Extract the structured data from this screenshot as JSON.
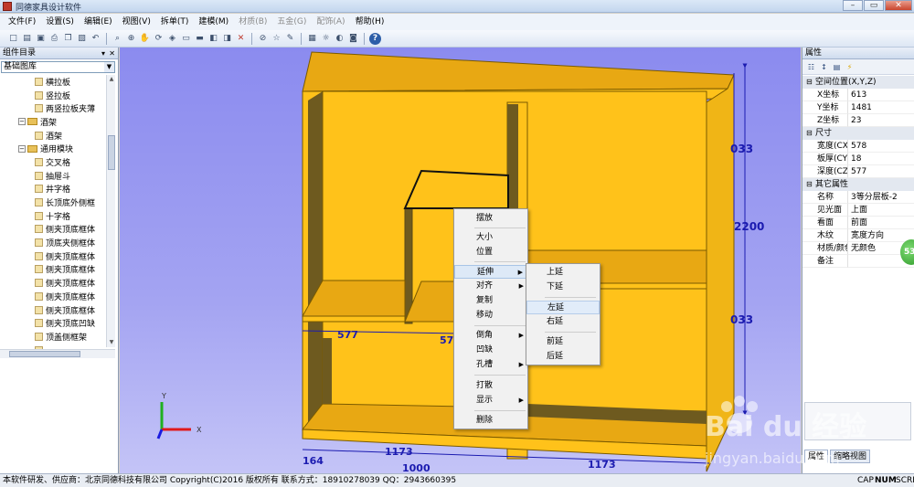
{
  "window": {
    "title": "同德家具设计软件",
    "controls": {
      "minimize": "–",
      "maximize": "▭",
      "close": "✕"
    }
  },
  "menubar": {
    "items": [
      {
        "label": "文件(F)",
        "enabled": true
      },
      {
        "label": "设置(S)",
        "enabled": true
      },
      {
        "label": "编辑(E)",
        "enabled": true
      },
      {
        "label": "视图(V)",
        "enabled": true
      },
      {
        "label": "拆单(T)",
        "enabled": true
      },
      {
        "label": "建模(M)",
        "enabled": true
      },
      {
        "label": "材质(B)",
        "enabled": false
      },
      {
        "label": "五金(G)",
        "enabled": false
      },
      {
        "label": "配饰(A)",
        "enabled": false
      },
      {
        "label": "帮助(H)",
        "enabled": true
      }
    ]
  },
  "toolbar": {
    "icons": [
      "new-icon",
      "open-icon",
      "save-icon",
      "print-icon",
      "copy-icon",
      "paste-icon",
      "undo-icon",
      "zoom-icon",
      "zoom-in-icon",
      "pan-icon",
      "rotate-icon",
      "view-3d-icon",
      "view-front-icon",
      "view-top-icon",
      "view-left-icon",
      "view-right-icon",
      "delete-icon",
      "measure-icon",
      "star-icon",
      "pencil-icon",
      "grid-icon",
      "light-icon",
      "render-icon",
      "camera-icon",
      "help-icon"
    ]
  },
  "left_panel": {
    "title": "组件目录",
    "pin": "▾",
    "close": "✕",
    "library": "基础图库",
    "tree": [
      {
        "label": "横拉板",
        "level": 3,
        "kind": "item"
      },
      {
        "label": "竖拉板",
        "level": 3,
        "kind": "item"
      },
      {
        "label": "两竖拉板夹薄",
        "level": 3,
        "kind": "item"
      },
      {
        "label": "酒架",
        "level": 2,
        "kind": "folder",
        "expander": "−"
      },
      {
        "label": "酒架",
        "level": 3,
        "kind": "item"
      },
      {
        "label": "通用模块",
        "level": 2,
        "kind": "folder",
        "expander": "−"
      },
      {
        "label": "交叉格",
        "level": 3,
        "kind": "item"
      },
      {
        "label": "抽屉斗",
        "level": 3,
        "kind": "item"
      },
      {
        "label": "井字格",
        "level": 3,
        "kind": "item"
      },
      {
        "label": "长顶底外侧框",
        "level": 3,
        "kind": "item"
      },
      {
        "label": "十字格",
        "level": 3,
        "kind": "item"
      },
      {
        "label": "侧夹顶底框体",
        "level": 3,
        "kind": "item"
      },
      {
        "label": "顶底夹侧框体",
        "level": 3,
        "kind": "item"
      },
      {
        "label": "侧夹顶底框体",
        "level": 3,
        "kind": "item"
      },
      {
        "label": "侧夹顶底框体",
        "level": 3,
        "kind": "item"
      },
      {
        "label": "侧夹顶底框体",
        "level": 3,
        "kind": "item"
      },
      {
        "label": "侧夹顶底框体",
        "level": 3,
        "kind": "item"
      },
      {
        "label": "侧夹顶底框体",
        "level": 3,
        "kind": "item"
      },
      {
        "label": "侧夹顶底凹缺",
        "level": 3,
        "kind": "item"
      },
      {
        "label": "顶盖侧框架",
        "level": 3,
        "kind": "item"
      },
      {
        "label": "",
        "level": 3,
        "kind": "item"
      }
    ]
  },
  "viewport": {
    "dimensions": {
      "top_depth": "033",
      "height": "2200",
      "bottom_depth": "033",
      "shelf_width_left": "577",
      "shelf_width_mid": "57",
      "bottom_left": "164",
      "bottom_mid": "1173",
      "bottom_right": "1173",
      "bottom_total": "1000"
    },
    "axes": {
      "x": "X",
      "y": "Y"
    }
  },
  "context_menu": {
    "items": [
      {
        "label": "摆放",
        "submenu": false
      },
      {
        "label": "大小",
        "submenu": false
      },
      {
        "label": "位置",
        "submenu": false
      },
      {
        "label": "延伸",
        "submenu": true,
        "active": true
      },
      {
        "label": "对齐",
        "submenu": true
      },
      {
        "label": "复制",
        "submenu": false
      },
      {
        "label": "移动",
        "submenu": false
      },
      {
        "label": "倒角",
        "submenu": true
      },
      {
        "label": "凹缺",
        "submenu": false
      },
      {
        "label": "孔槽",
        "submenu": true
      },
      {
        "label": "打散",
        "submenu": false
      },
      {
        "label": "显示",
        "submenu": true
      },
      {
        "label": "删除",
        "submenu": false
      }
    ],
    "submenu_arrow": "▶"
  },
  "submenu": {
    "items": [
      {
        "label": "上延"
      },
      {
        "label": "下延"
      },
      {
        "label": "左延",
        "highlighted": true
      },
      {
        "label": "右延"
      },
      {
        "label": "前延"
      },
      {
        "label": "后延"
      }
    ]
  },
  "properties": {
    "title": "属性",
    "categories": [
      {
        "name": "空间位置(X,Y,Z)",
        "rows": [
          {
            "key": "X坐标",
            "value": "613"
          },
          {
            "key": "Y坐标",
            "value": "1481"
          },
          {
            "key": "Z坐标",
            "value": "23"
          }
        ]
      },
      {
        "name": "尺寸",
        "rows": [
          {
            "key": "宽度(CX)",
            "value": "578"
          },
          {
            "key": "板厚(CY)",
            "value": "18"
          },
          {
            "key": "深度(CZ)",
            "value": "577"
          }
        ]
      },
      {
        "name": "其它属性",
        "rows": [
          {
            "key": "名称",
            "value": "3等分层板-2"
          },
          {
            "key": "见光面",
            "value": "上面"
          },
          {
            "key": "看面",
            "value": "前面"
          },
          {
            "key": "木纹",
            "value": "宽度方向"
          },
          {
            "key": "材质/颜色",
            "value": "无颜色"
          },
          {
            "key": "备注",
            "value": ""
          }
        ]
      }
    ],
    "tabs": [
      "属性",
      "缩略视图"
    ],
    "badge": "53"
  },
  "statusbar": {
    "message": "本软件研发、供应商：北京同德科技有限公司  Copyright(C)2016 版权所有  联系方式：18910278039  QQ：2943660395",
    "indicators": [
      "CAP",
      "NUM",
      "SCRL"
    ]
  },
  "watermark": {
    "brand": "Bai du 经验",
    "url": "jingyan.baidu.com"
  },
  "colors": {
    "board": "#ffc21a",
    "board_edge": "#7a5a00",
    "back_panel": "#6e5a1f",
    "viewport_bg": "#9a9af0",
    "dimension": "#1b1bb0"
  }
}
